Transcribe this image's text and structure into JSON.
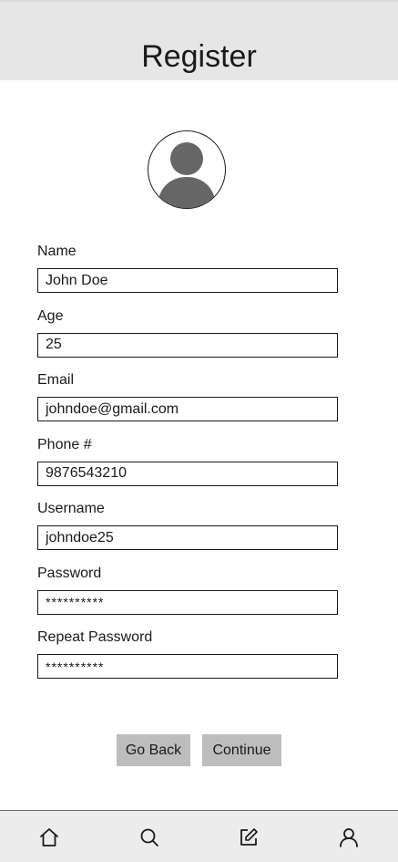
{
  "header": {
    "title": "Register"
  },
  "avatar": {
    "icon": "user-avatar-icon"
  },
  "form": {
    "fields": [
      {
        "label": "Name",
        "value": "John Doe"
      },
      {
        "label": "Age",
        "value": "25"
      },
      {
        "label": "Email",
        "value": "johndoe@gmail.com"
      },
      {
        "label": "Phone #",
        "value": "9876543210"
      },
      {
        "label": "Username",
        "value": "johndoe25"
      },
      {
        "label": "Password",
        "value": "**********"
      },
      {
        "label": "Repeat Password",
        "value": "**********"
      }
    ]
  },
  "actions": {
    "back_label": "Go Back",
    "continue_label": "Continue"
  },
  "tabbar": {
    "items": [
      "home-icon",
      "search-icon",
      "edit-icon",
      "profile-icon"
    ]
  },
  "colors": {
    "header_bg": "#e6e6e6",
    "button_bg": "#bdbdbd",
    "tabbar_bg": "#ececec",
    "avatar_fill": "#666666"
  }
}
